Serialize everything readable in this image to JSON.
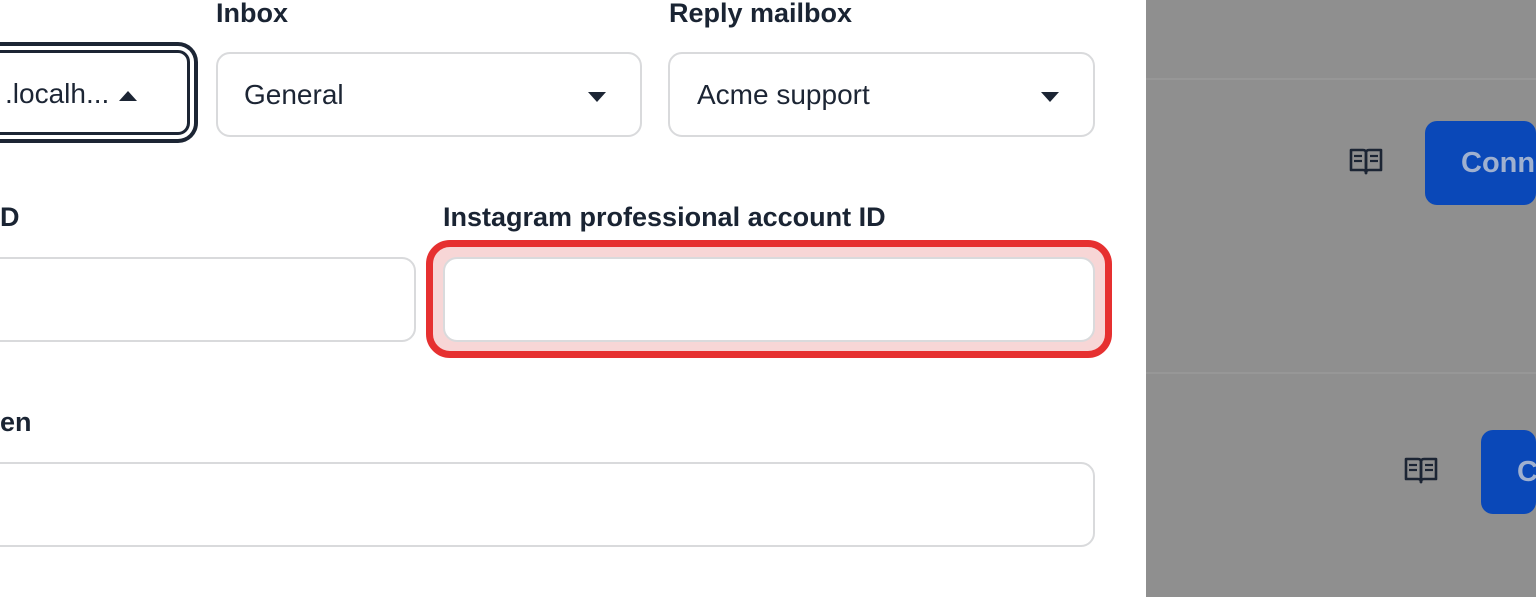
{
  "background_page": {
    "connect_label": "Connect",
    "connect_label_short": "C",
    "docs_icon": "book-open-icon",
    "colors": {
      "overlay": "#8f8f8f",
      "connect_button": "#0a48b8"
    }
  },
  "form": {
    "integration_select": {
      "value": ".localh...",
      "icon": "caret-up-icon"
    },
    "inbox": {
      "label": "Inbox",
      "value": "General",
      "icon": "caret-down-icon"
    },
    "reply_mailbox": {
      "label": "Reply mailbox",
      "value": "Acme support",
      "icon": "caret-down-icon"
    },
    "page_id": {
      "label": "D",
      "value": "",
      "placeholder": ""
    },
    "instagram_account_id": {
      "label": "Instagram professional account ID",
      "value": "",
      "placeholder": ""
    },
    "access_token": {
      "label": "en",
      "value": "",
      "placeholder": ""
    },
    "colors": {
      "highlight": "#e63030",
      "text": "#1a2433",
      "border": "#d9dadc"
    }
  }
}
